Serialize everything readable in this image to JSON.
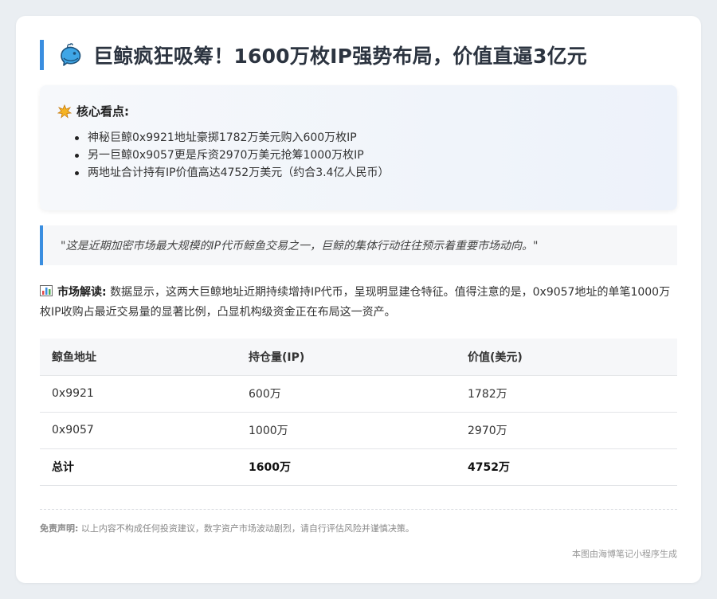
{
  "title": "巨鲸疯狂吸筹！1600万枚IP强势布局，价值直逼3亿元",
  "title_icon": "whale-icon",
  "highlights": {
    "icon": "star-burst-icon",
    "heading": "核心看点:",
    "items": [
      "神秘巨鲸0x9921地址豪掷1782万美元购入600万枚IP",
      "另一巨鲸0x9057更是斥资2970万美元抢筹1000万枚IP",
      "两地址合计持有IP价值高达4752万美元（约合3.4亿人民币）"
    ]
  },
  "quote": "\"这是近期加密市场最大规模的IP代币鲸鱼交易之一，巨鲸的集体行动往往预示着重要市场动向。\"",
  "analysis": {
    "icon": "bar-chart-icon",
    "label": "市场解读:",
    "text": "数据显示，这两大巨鲸地址近期持续增持IP代币，呈现明显建仓特征。值得注意的是，0x9057地址的单笔1000万枚IP收购占最近交易量的显著比例，凸显机构级资金正在布局这一资产。"
  },
  "table": {
    "headers": [
      "鲸鱼地址",
      "持仓量(IP)",
      "价值(美元)"
    ],
    "rows": [
      [
        "0x9921",
        "600万",
        "1782万"
      ],
      [
        "0x9057",
        "1000万",
        "2970万"
      ]
    ],
    "total": [
      "总计",
      "1600万",
      "4752万"
    ]
  },
  "disclaimer": {
    "label": "免责声明:",
    "text": "以上内容不构成任何投资建议，数字资产市场波动剧烈，请自行评估风险并谨慎决策。"
  },
  "footer": "本图由海博笔记小程序生成",
  "colors": {
    "accent": "#3a8ee0",
    "title": "#2c3440"
  }
}
